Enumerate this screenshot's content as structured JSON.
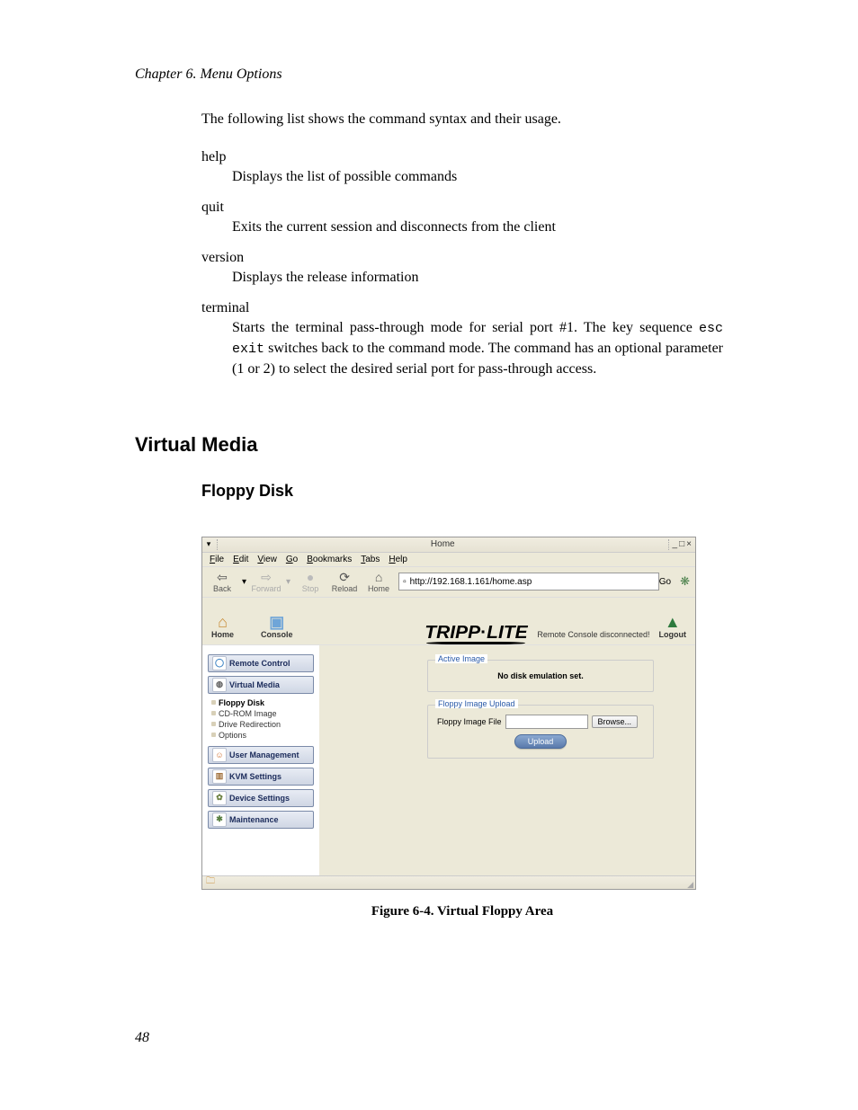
{
  "chapter_header": "Chapter 6. Menu Options",
  "intro_text": "The following list shows the command syntax and their usage.",
  "terms": {
    "help": {
      "label": "help",
      "def": "Displays the list of possible commands"
    },
    "quit": {
      "label": "quit",
      "def": "Exits the current session and disconnects from the client"
    },
    "version": {
      "label": "version",
      "def": "Displays the release information"
    },
    "terminal": {
      "label": "terminal",
      "def_pre": "Starts the terminal pass-through mode for serial port #1. The key sequence ",
      "def_code1": "esc",
      "def_mid": " ",
      "def_code2": "exit",
      "def_post": " switches back to the command mode. The command has an optional parameter (1 or 2) to select the desired serial port for pass-through access."
    }
  },
  "h1_virtual_media": "Virtual Media",
  "h2_floppy_disk": "Floppy Disk",
  "figure_caption": "Figure 6-4. Virtual Floppy Area",
  "page_number": "48",
  "shot": {
    "window_title": "Home",
    "window_controls": {
      "min": "_",
      "max": "□",
      "close": "×"
    },
    "menubar": [
      "File",
      "Edit",
      "View",
      "Go",
      "Bookmarks",
      "Tabs",
      "Help"
    ],
    "toolbar": {
      "back": "Back",
      "forward": "Forward",
      "stop": "Stop",
      "reload": "Reload",
      "home": "Home",
      "go": "Go"
    },
    "url": "http://192.168.1.161/home.asp",
    "top_buttons": {
      "home": "Home",
      "console": "Console",
      "logout": "Logout"
    },
    "logo_text": "TRIPP·LITE",
    "status_text": "Remote Console disconnected!",
    "sidebar": {
      "remote_control": "Remote Control",
      "virtual_media": "Virtual Media",
      "sub": {
        "floppy": "Floppy Disk",
        "cdrom": "CD-ROM Image",
        "drive": "Drive Redirection",
        "options": "Options"
      },
      "user_mgmt": "User Management",
      "kvm": "KVM Settings",
      "device": "Device Settings",
      "maint": "Maintenance"
    },
    "panel": {
      "active_image_legend": "Active Image",
      "active_image_text": "No disk emulation set.",
      "upload_legend": "Floppy Image Upload",
      "upload_label": "Floppy Image File",
      "browse": "Browse...",
      "upload": "Upload"
    }
  }
}
